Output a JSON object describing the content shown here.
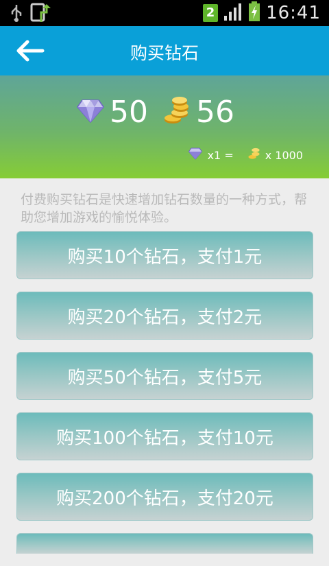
{
  "status_bar": {
    "sim_slot": "2",
    "time": "16:41"
  },
  "header": {
    "title": "购买钻石",
    "back_icon": "arrow-left-icon"
  },
  "balance": {
    "diamonds": "50",
    "coins": "56",
    "rate_left": "x1 =",
    "rate_right": "x 1000"
  },
  "description": "付费购买钻石是快速增加钻石数量的一种方式，帮助您增加游戏的愉悦体验。",
  "options": [
    {
      "label": "购买10个钻石，支付1元"
    },
    {
      "label": "购买20个钻石，支付2元"
    },
    {
      "label": "购买50个钻石，支付5元"
    },
    {
      "label": "购买100个钻石，支付10元"
    },
    {
      "label": "购买200个钻石，支付20元"
    }
  ],
  "colors": {
    "title_bar": "#0aa0d8",
    "button_top": "#6cbbbb",
    "header_green": "#86cd35"
  }
}
